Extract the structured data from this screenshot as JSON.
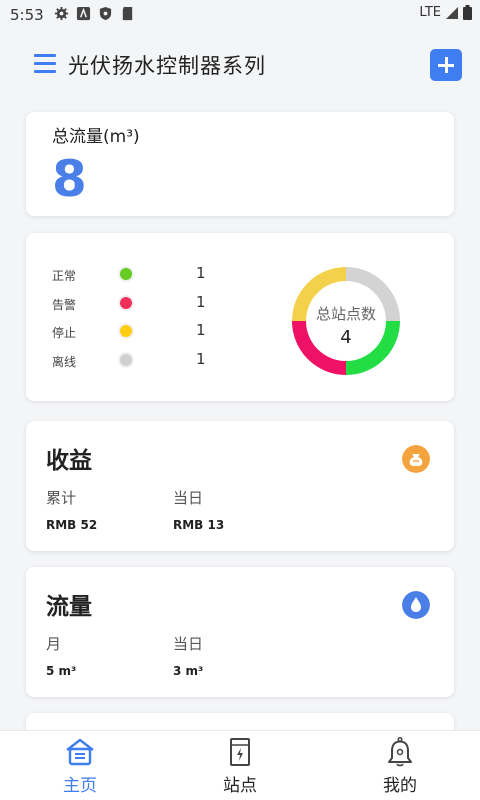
{
  "status_bar": {
    "time": "5:53",
    "network": "LTE"
  },
  "header": {
    "title": "光伏扬水控制器系列"
  },
  "total_flow": {
    "label": "总流量(m³)",
    "value": "8"
  },
  "station_status": {
    "rows": [
      {
        "label": "正常",
        "value": "1",
        "color": "#66cc22"
      },
      {
        "label": "告警",
        "value": "1",
        "color": "#f0305a"
      },
      {
        "label": "停止",
        "value": "1",
        "color": "#ffcc11"
      },
      {
        "label": "离线",
        "value": "1",
        "color": "#d0d0d0"
      }
    ],
    "donut": {
      "label": "总站点数",
      "value": "4",
      "segments": [
        {
          "name": "正常",
          "value": 1,
          "color": "#22dd44"
        },
        {
          "name": "告警",
          "value": 1,
          "color": "#ee1166"
        },
        {
          "name": "停止",
          "value": 1,
          "color": "#f3d14b"
        },
        {
          "name": "离线",
          "value": 1,
          "color": "#d3d3d3"
        }
      ]
    }
  },
  "income": {
    "title": "收益",
    "icon": "money-bag-icon",
    "icon_color": "#f5a33c",
    "cumulative_label": "累计",
    "cumulative_value": "RMB 52",
    "today_label": "当日",
    "today_value": "RMB 13"
  },
  "water": {
    "title": "流量",
    "icon": "water-drop-icon",
    "icon_color": "#4a7fe8",
    "month_label": "月",
    "month_value": "5 m³",
    "today_label": "当日",
    "today_value": "3 m³"
  },
  "bottom_nav": [
    {
      "label": "主页",
      "icon": "home-icon",
      "active": true
    },
    {
      "label": "站点",
      "icon": "station-icon",
      "active": false
    },
    {
      "label": "我的",
      "icon": "bell-icon",
      "active": false
    }
  ],
  "colors": {
    "accent": "#3f7ef2"
  }
}
